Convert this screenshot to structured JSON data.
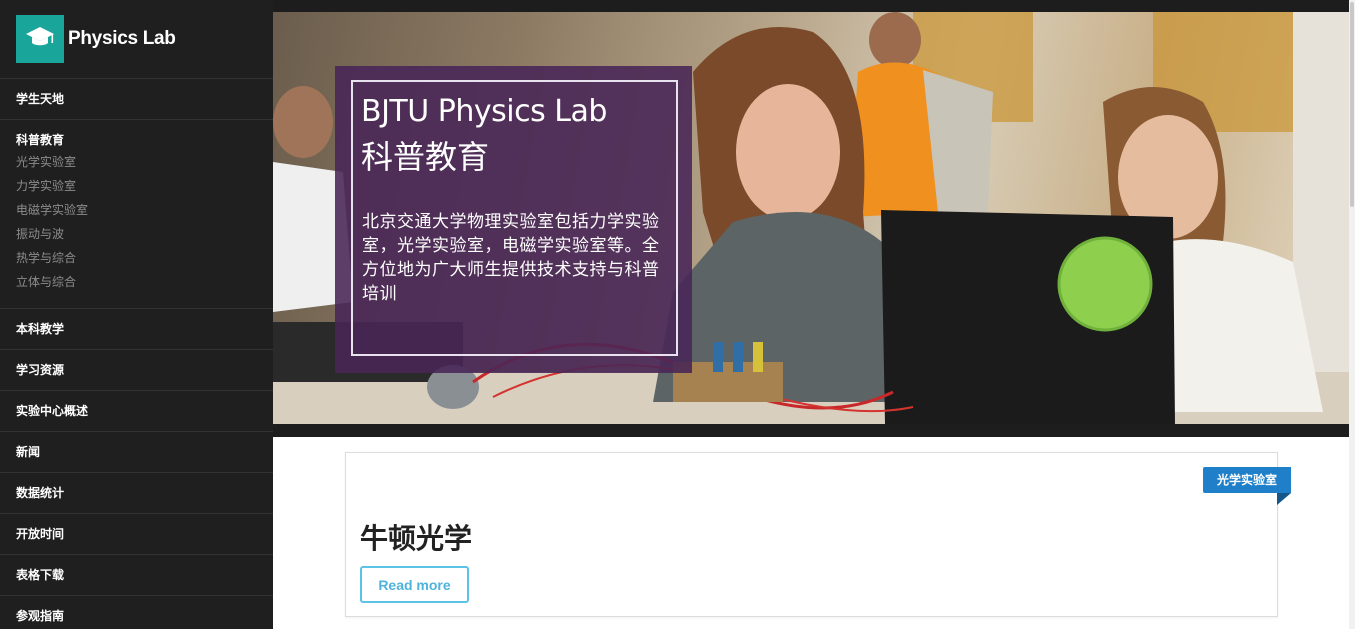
{
  "brand": {
    "name": "Physics Lab",
    "icon": "graduation-cap-icon",
    "color": "#1aa59a"
  },
  "sidebar": {
    "sections": [
      {
        "label": "学生天地",
        "items": []
      },
      {
        "label": "科普教育",
        "items": [
          "光学实验室",
          "力学实验室",
          "电磁学实验室",
          "振动与波",
          "热学与综合",
          "立体与综合"
        ]
      },
      {
        "label": "本科教学",
        "items": []
      },
      {
        "label": "学习资源",
        "items": []
      },
      {
        "label": "实验中心概述",
        "items": []
      },
      {
        "label": "新闻",
        "items": []
      },
      {
        "label": "数据统计",
        "items": []
      },
      {
        "label": "开放时间",
        "items": []
      },
      {
        "label": "表格下载",
        "items": []
      },
      {
        "label": "参观指南",
        "items": []
      }
    ]
  },
  "hero": {
    "title": "BJTU Physics Lab",
    "subtitle": "科普教育",
    "description": "北京交通大学物理实验室包括力学实验室，光学实验室，电磁学实验室等。全方位地为广大师生提供技术支持与科普培训"
  },
  "card": {
    "tag": "光学实验室",
    "title": "牛顿光学",
    "button": "Read more"
  },
  "colors": {
    "sidebar_bg": "#1f1f1f",
    "overlay": "#482656",
    "ribbon": "#1f7fc9",
    "button_border": "#5bc3e6"
  }
}
